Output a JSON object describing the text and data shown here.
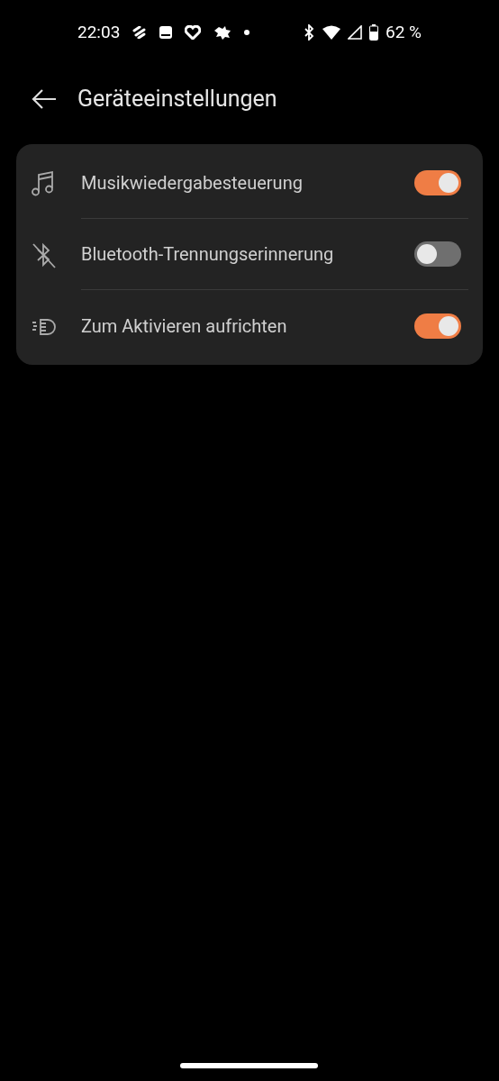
{
  "status_bar": {
    "time": "22:03",
    "battery": "62 %"
  },
  "header": {
    "title": "Geräteeinstellungen"
  },
  "settings": [
    {
      "kind": "music",
      "label": "Musikwiedergabesteuerung",
      "on": true
    },
    {
      "kind": "bluetooth",
      "label": "Bluetooth-Trennungserinnerung",
      "on": false
    },
    {
      "kind": "raise",
      "label": "Zum Aktivieren aufrichten",
      "on": true
    }
  ]
}
